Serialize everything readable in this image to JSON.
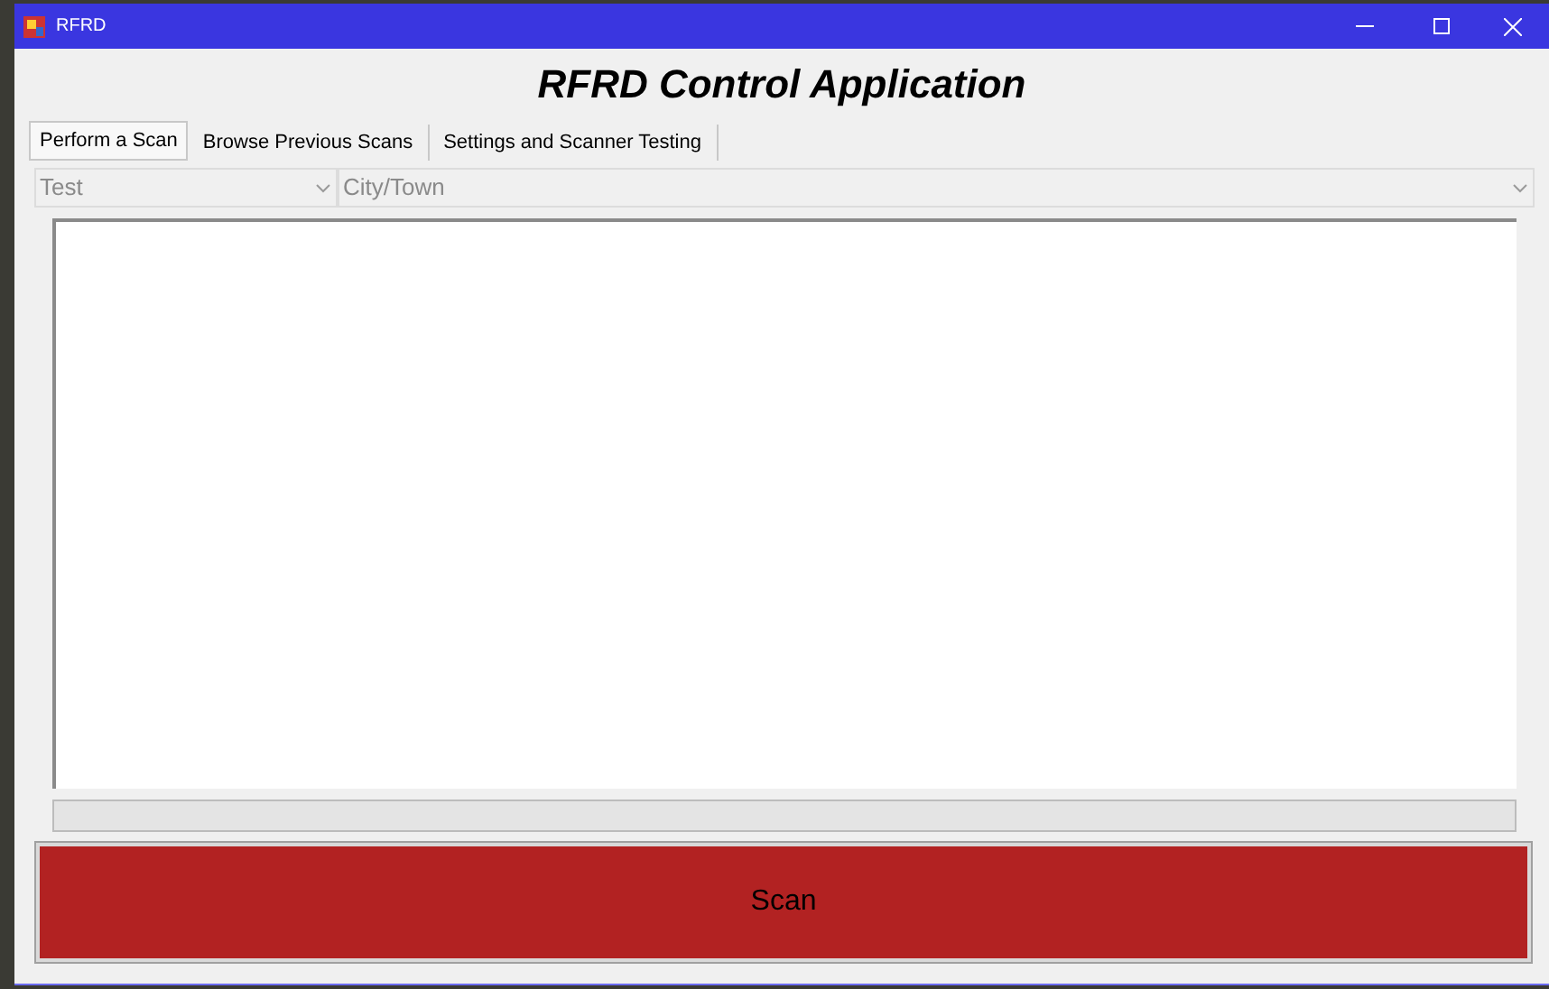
{
  "window": {
    "title": "RFRD"
  },
  "heading": "RFRD Control Application",
  "tabs": [
    {
      "label": "Perform a Scan",
      "selected": true
    },
    {
      "label": "Browse Previous Scans",
      "selected": false
    },
    {
      "label": "Settings and Scanner Testing",
      "selected": false
    }
  ],
  "dropdowns": [
    {
      "value": "Test",
      "disabled": true
    },
    {
      "value": "City/Town",
      "disabled": true
    }
  ],
  "progress": {
    "level": 0
  },
  "scan_button": {
    "label": "Scan"
  }
}
